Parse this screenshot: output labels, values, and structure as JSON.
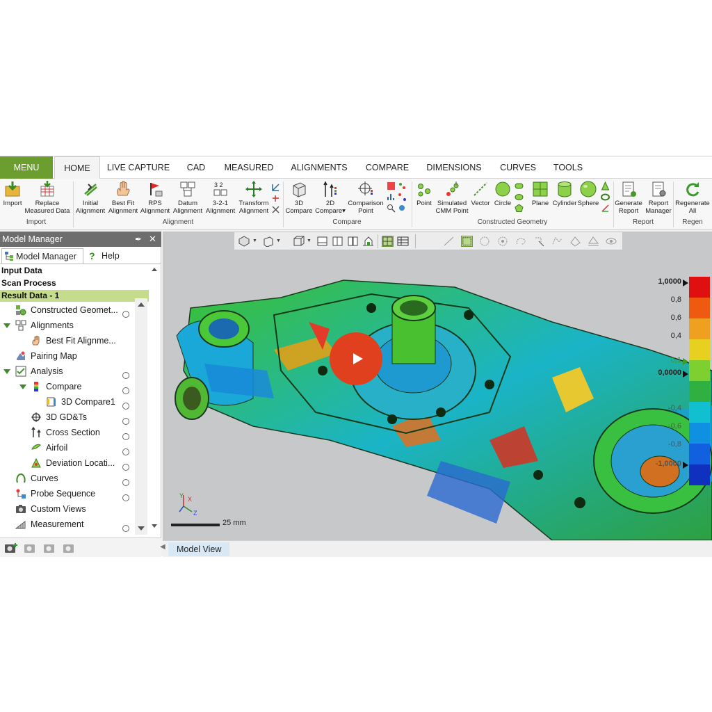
{
  "tabs": [
    {
      "label": "MENU"
    },
    {
      "label": "HOME"
    },
    {
      "label": "LIVE CAPTURE"
    },
    {
      "label": "CAD"
    },
    {
      "label": "MEASURED"
    },
    {
      "label": "ALIGNMENTS"
    },
    {
      "label": "COMPARE"
    },
    {
      "label": "DIMENSIONS"
    },
    {
      "label": "CURVES"
    },
    {
      "label": "TOOLS"
    }
  ],
  "ribbon": {
    "buttons": [
      {
        "l1": "Import",
        "l2": ""
      },
      {
        "l1": "Replace",
        "l2": "Measured Data"
      },
      {
        "l1": "Initial",
        "l2": "Alignment"
      },
      {
        "l1": "Best Fit",
        "l2": "Alignment"
      },
      {
        "l1": "RPS",
        "l2": "Alignment"
      },
      {
        "l1": "Datum",
        "l2": "Alignment"
      },
      {
        "l1": "3-2-1",
        "l2": "Alignment"
      },
      {
        "l1": "Transform",
        "l2": "Alignment"
      },
      {
        "l1": "3D",
        "l2": "Compare"
      },
      {
        "l1": "2D",
        "l2": "Compare▾"
      },
      {
        "l1": "Comparison",
        "l2": "Point"
      },
      {
        "l1": "Point",
        "l2": ""
      },
      {
        "l1": "Simulated",
        "l2": "CMM Point"
      },
      {
        "l1": "Vector",
        "l2": ""
      },
      {
        "l1": "Circle",
        "l2": ""
      },
      {
        "l1": "Plane",
        "l2": ""
      },
      {
        "l1": "Cylinder",
        "l2": ""
      },
      {
        "l1": "Sphere",
        "l2": ""
      },
      {
        "l1": "Generate",
        "l2": "Report"
      },
      {
        "l1": "Report",
        "l2": "Manager"
      },
      {
        "l1": "Regenerate",
        "l2": "All"
      }
    ],
    "groups": [
      "Import",
      "Alignment",
      "Compare",
      "Constructed Geometry",
      "Report",
      "Regen"
    ]
  },
  "left_panel": {
    "title": "Model Manager",
    "pin": "❁",
    "close": "✕",
    "tab_model_manager": "Model Manager",
    "tab_help": "Help",
    "headers": [
      "Input Data",
      "Scan Process",
      "Result Data - 1"
    ],
    "tree": [
      {
        "label": "Constructed Geomet..."
      },
      {
        "label": "Alignments"
      },
      {
        "label": "Best Fit Alignme..."
      },
      {
        "label": "Pairing Map"
      },
      {
        "label": "Analysis"
      },
      {
        "label": "Compare"
      },
      {
        "label": "3D Compare1"
      },
      {
        "label": "3D GD&Ts"
      },
      {
        "label": "Cross Section"
      },
      {
        "label": "Airfoil"
      },
      {
        "label": "Deviation Locati..."
      },
      {
        "label": "Curves"
      },
      {
        "label": "Probe Sequence"
      },
      {
        "label": "Custom Views"
      },
      {
        "label": "Measurement"
      }
    ]
  },
  "legend": {
    "labels": [
      "1,0000",
      "0,8",
      "0,6",
      "0,4",
      "0,1",
      "0,0000",
      "-0,4",
      "-0,6",
      "-0,8",
      "-1,0000"
    ],
    "colors": [
      "#e01010",
      "#f05a10",
      "#f0a020",
      "#e8d020",
      "#7ed030",
      "#30b040",
      "#10c0d0",
      "#1090e0",
      "#1060e0",
      "#1030c0"
    ]
  },
  "viewport": {
    "scale_label": "25 mm",
    "tab_label": "Model View"
  }
}
